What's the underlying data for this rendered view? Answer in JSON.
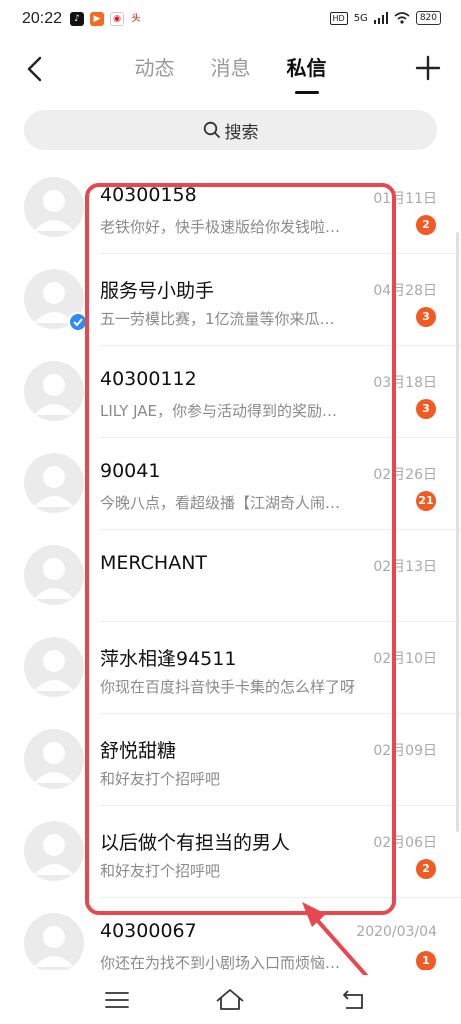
{
  "status_bar": {
    "time": "20:22",
    "signal": "5G",
    "battery": "820"
  },
  "header": {
    "tabs": [
      {
        "label": "动态",
        "active": false
      },
      {
        "label": "消息",
        "active": false
      },
      {
        "label": "私信",
        "active": true
      }
    ]
  },
  "search": {
    "placeholder": "搜索"
  },
  "conversations": [
    {
      "name": "40300158",
      "date": "01月11日",
      "preview": "老铁你好，快手极速版给你发钱啦…",
      "unread": "2",
      "verified": false
    },
    {
      "name": "服务号小助手",
      "date": "04月28日",
      "preview": "五一劳模比赛，1亿流量等你来瓜…",
      "unread": "3",
      "verified": true
    },
    {
      "name": "40300112",
      "date": "03月18日",
      "preview": "LILY JAE，你参与活动得到的奖励…",
      "unread": "3",
      "verified": false
    },
    {
      "name": "90041",
      "date": "02月26日",
      "preview": "今晚八点，看超级播【江湖奇人闹…",
      "unread": "21",
      "verified": false
    },
    {
      "name": "MERCHANT",
      "date": "02月13日",
      "preview": "",
      "unread": "",
      "verified": false
    },
    {
      "name": "萍水相逢94511",
      "date": "02月10日",
      "preview": "你现在百度抖音快手卡集的怎么样了呀",
      "unread": "",
      "verified": false
    },
    {
      "name": "舒悦甜糖",
      "date": "02月09日",
      "preview": "和好友打个招呼吧",
      "unread": "",
      "verified": false
    },
    {
      "name": "以后做个有担当的男人",
      "date": "02月06日",
      "preview": "和好友打个招呼吧",
      "unread": "2",
      "verified": false
    },
    {
      "name": "40300067",
      "date": "2020/03/04",
      "preview": "你还在为找不到小剧场入口而烦恼…",
      "unread": "1",
      "verified": false
    }
  ],
  "colors": {
    "badge": "#f15a22",
    "annotation": "#e8474f",
    "verified": "#2d8cf0"
  }
}
